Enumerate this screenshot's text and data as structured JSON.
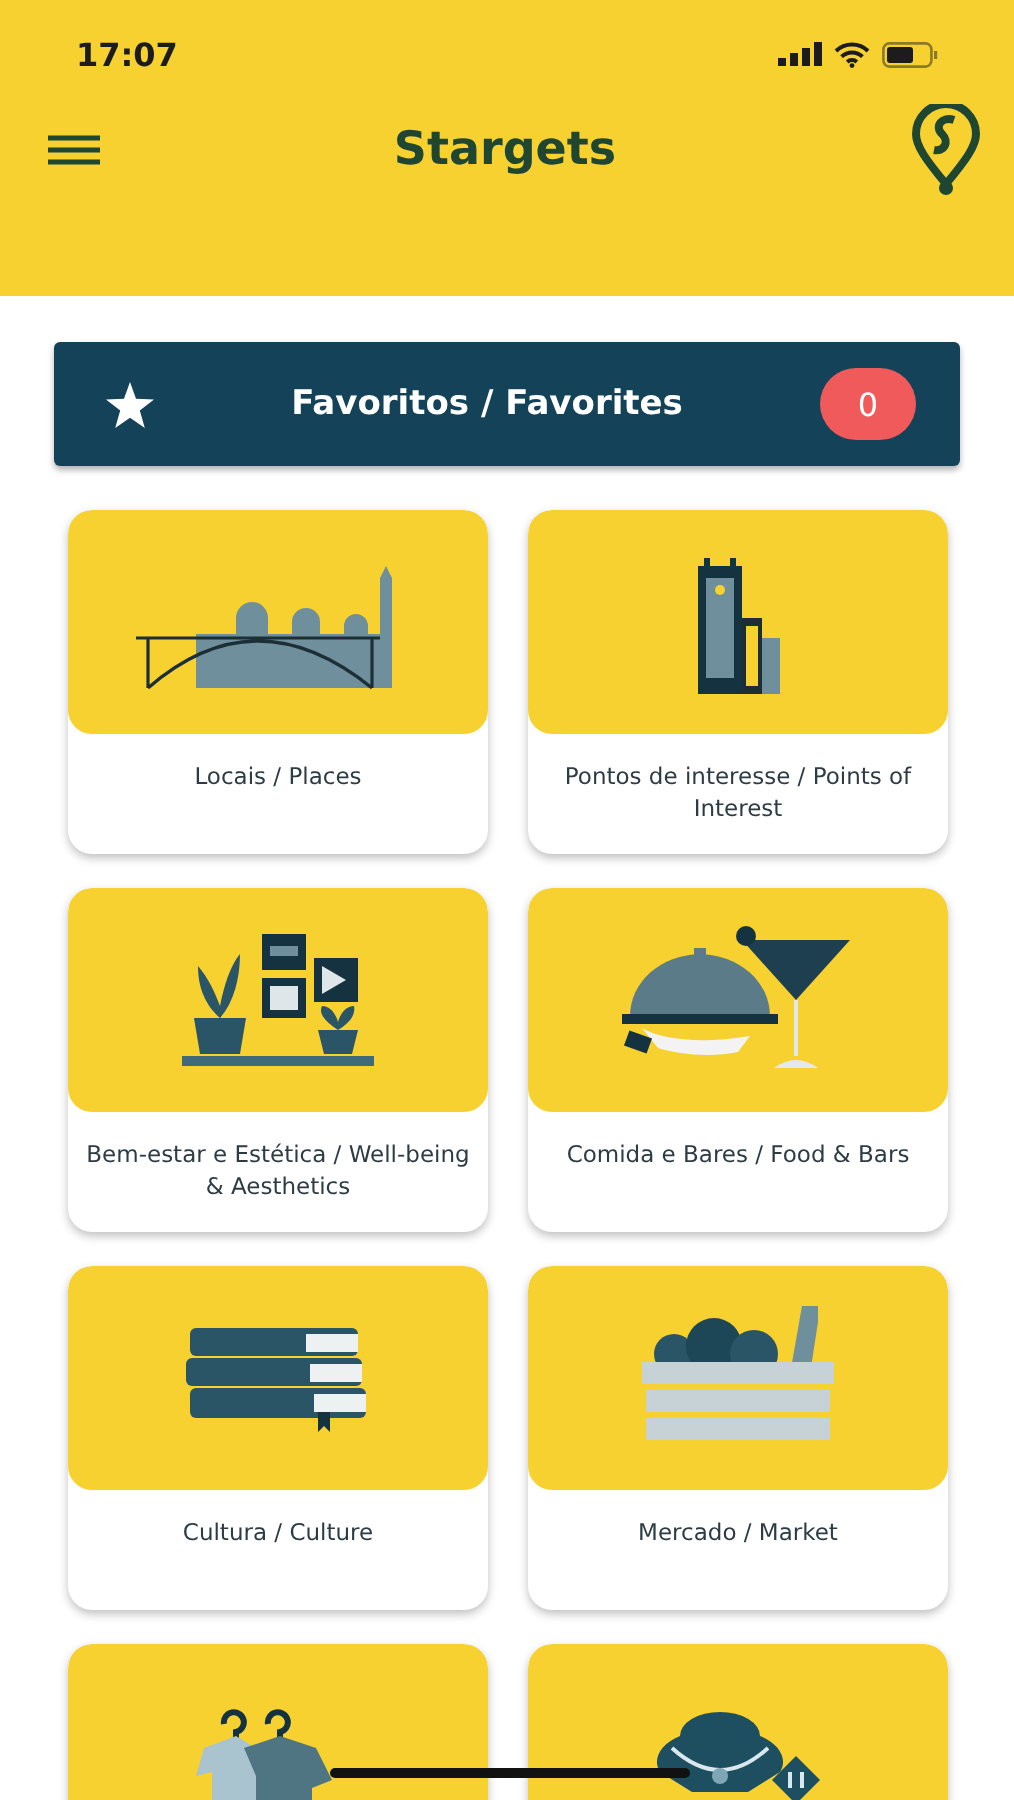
{
  "status_bar": {
    "time": "17:07"
  },
  "header": {
    "title": "Stargets"
  },
  "favorites": {
    "label": "Favoritos / Favorites",
    "count": "0"
  },
  "categories": [
    {
      "kind": "skyline",
      "label": "Locais / Places"
    },
    {
      "kind": "tower",
      "label": "Pontos de interesse / Points of Interest"
    },
    {
      "kind": "plants",
      "label": "Bem-estar e Estética / Well-being & Aesthetics"
    },
    {
      "kind": "food",
      "label": "Comida e Bares / Food & Bars"
    },
    {
      "kind": "books",
      "label": "Cultura / Culture"
    },
    {
      "kind": "crate",
      "label": "Mercado / Market"
    },
    {
      "kind": "clothes"
    },
    {
      "kind": "jewelry"
    }
  ]
}
